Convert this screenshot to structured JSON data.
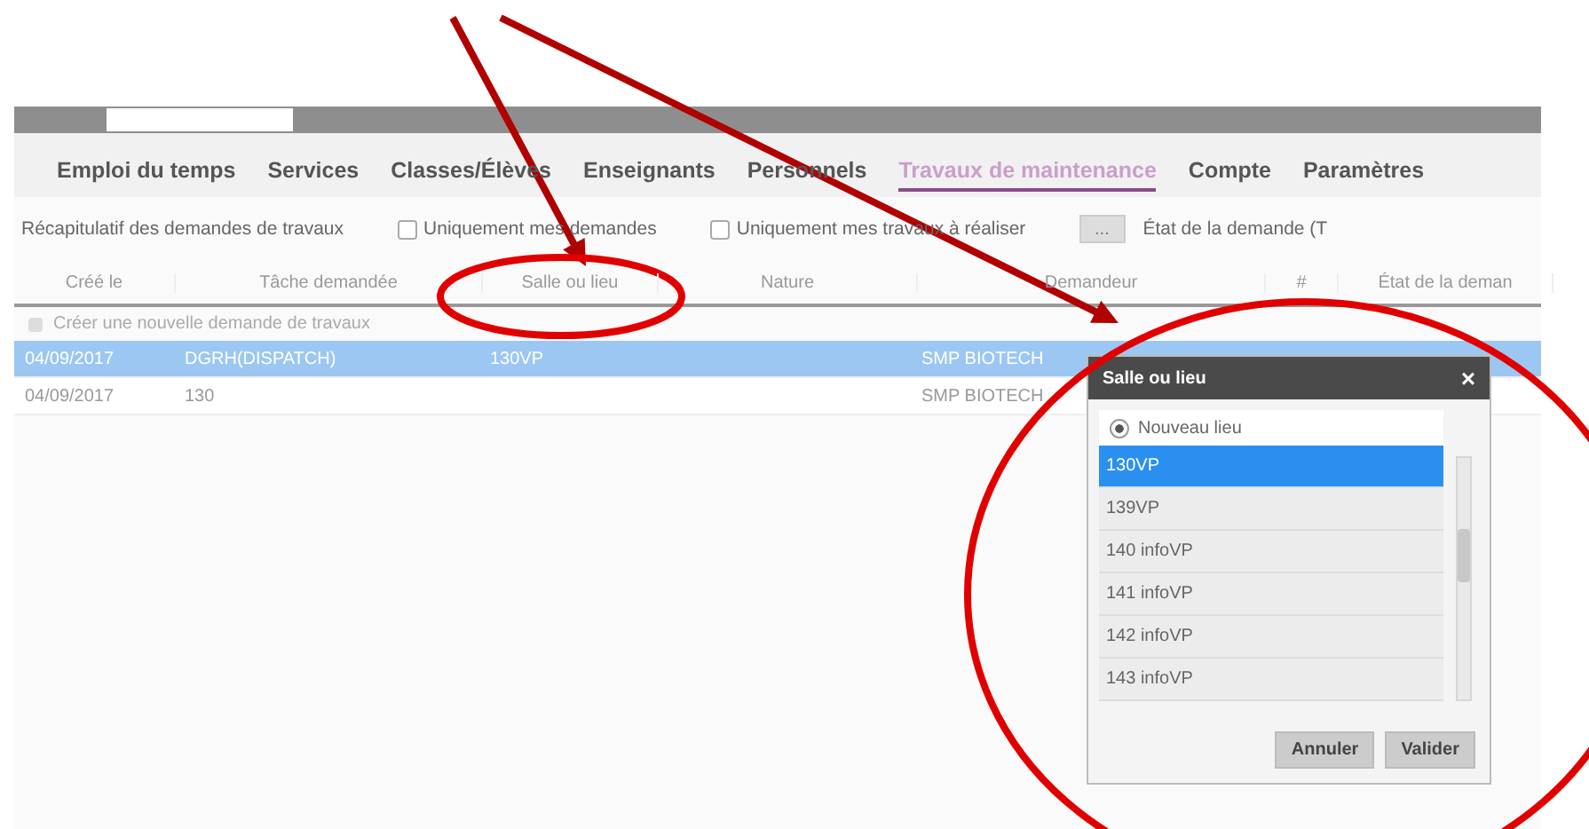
{
  "menu": [
    {
      "label": "Emploi du temps",
      "selected": false
    },
    {
      "label": "Services",
      "selected": false
    },
    {
      "label": "Classes/Élèves",
      "selected": false
    },
    {
      "label": "Enseignants",
      "selected": false
    },
    {
      "label": "Personnels",
      "selected": false
    },
    {
      "label": "Travaux de maintenance",
      "selected": true
    },
    {
      "label": "Compte",
      "selected": false
    },
    {
      "label": "Paramètres",
      "selected": false
    }
  ],
  "toolbar": {
    "title": "Récapitulatif des demandes de travaux",
    "filters": [
      {
        "label": "Uniquement mes demandes",
        "checked": false
      },
      {
        "label": "Uniquement mes travaux à réaliser",
        "checked": false
      }
    ],
    "state_button": "...",
    "state_label": "État de la demande (T"
  },
  "table": {
    "columns": [
      "Créé le",
      "Tâche demandée",
      "Salle ou lieu",
      "Nature",
      "Demandeur",
      "#",
      "État de la deman"
    ],
    "create_row": "Créer une nouvelle demande de travaux",
    "rows": [
      {
        "selected": true,
        "cells": [
          "04/09/2017",
          "DGRH(DISPATCH)",
          "130VP",
          "",
          "SMP BIOTECH",
          "",
          ""
        ]
      },
      {
        "selected": false,
        "cells": [
          "04/09/2017",
          "130",
          "",
          "",
          "SMP BIOTECH",
          "",
          ""
        ]
      }
    ]
  },
  "dialog": {
    "title": "Salle ou lieu",
    "close": "×",
    "new_place": {
      "label": "Nouveau lieu",
      "checked": true
    },
    "items": [
      {
        "label": "130VP",
        "selected": true
      },
      {
        "label": "139VP",
        "selected": false
      },
      {
        "label": "140 infoVP",
        "selected": false
      },
      {
        "label": "141 infoVP",
        "selected": false
      },
      {
        "label": "142 infoVP",
        "selected": false
      },
      {
        "label": "143 infoVP",
        "selected": false
      }
    ],
    "buttons": [
      "Annuler",
      "Valider"
    ]
  }
}
